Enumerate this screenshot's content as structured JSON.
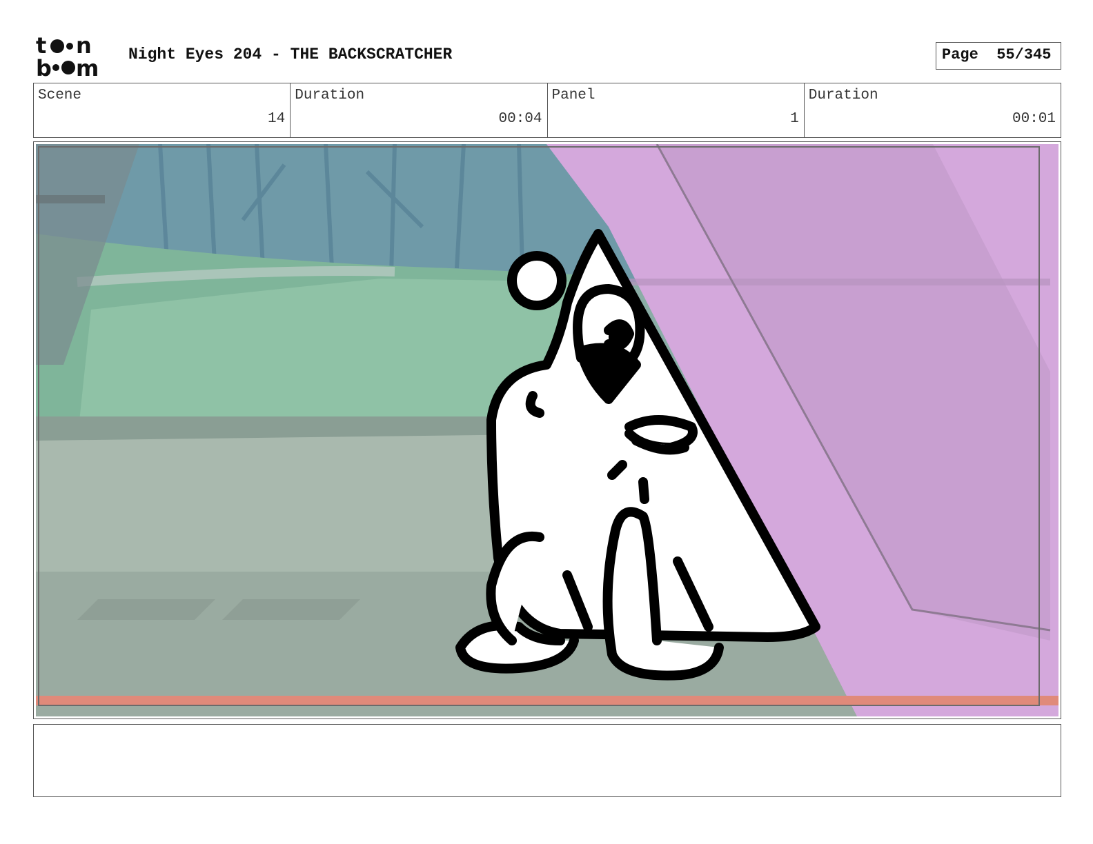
{
  "header": {
    "logo_top": "t o n",
    "logo_bottom": "b o m",
    "title": "Night Eyes 204 - THE BACKSCRATCHER",
    "page_label": "Page",
    "page_value": "55/345"
  },
  "info": {
    "scene_label": "Scene",
    "scene_value": "14",
    "scene_duration_label": "Duration",
    "scene_duration_value": "00:04",
    "panel_label": "Panel",
    "panel_value": "1",
    "panel_duration_label": "Duration",
    "panel_duration_value": "00:01"
  },
  "panel": {
    "colors": {
      "sky": "#8aada6",
      "trees": "#5f8fa0",
      "grass": "#7fb59a",
      "ground": "#a5b7ac",
      "pink": "#d4a8dc",
      "safe_line": "#e08a7a"
    }
  },
  "notes": {
    "text": ""
  }
}
